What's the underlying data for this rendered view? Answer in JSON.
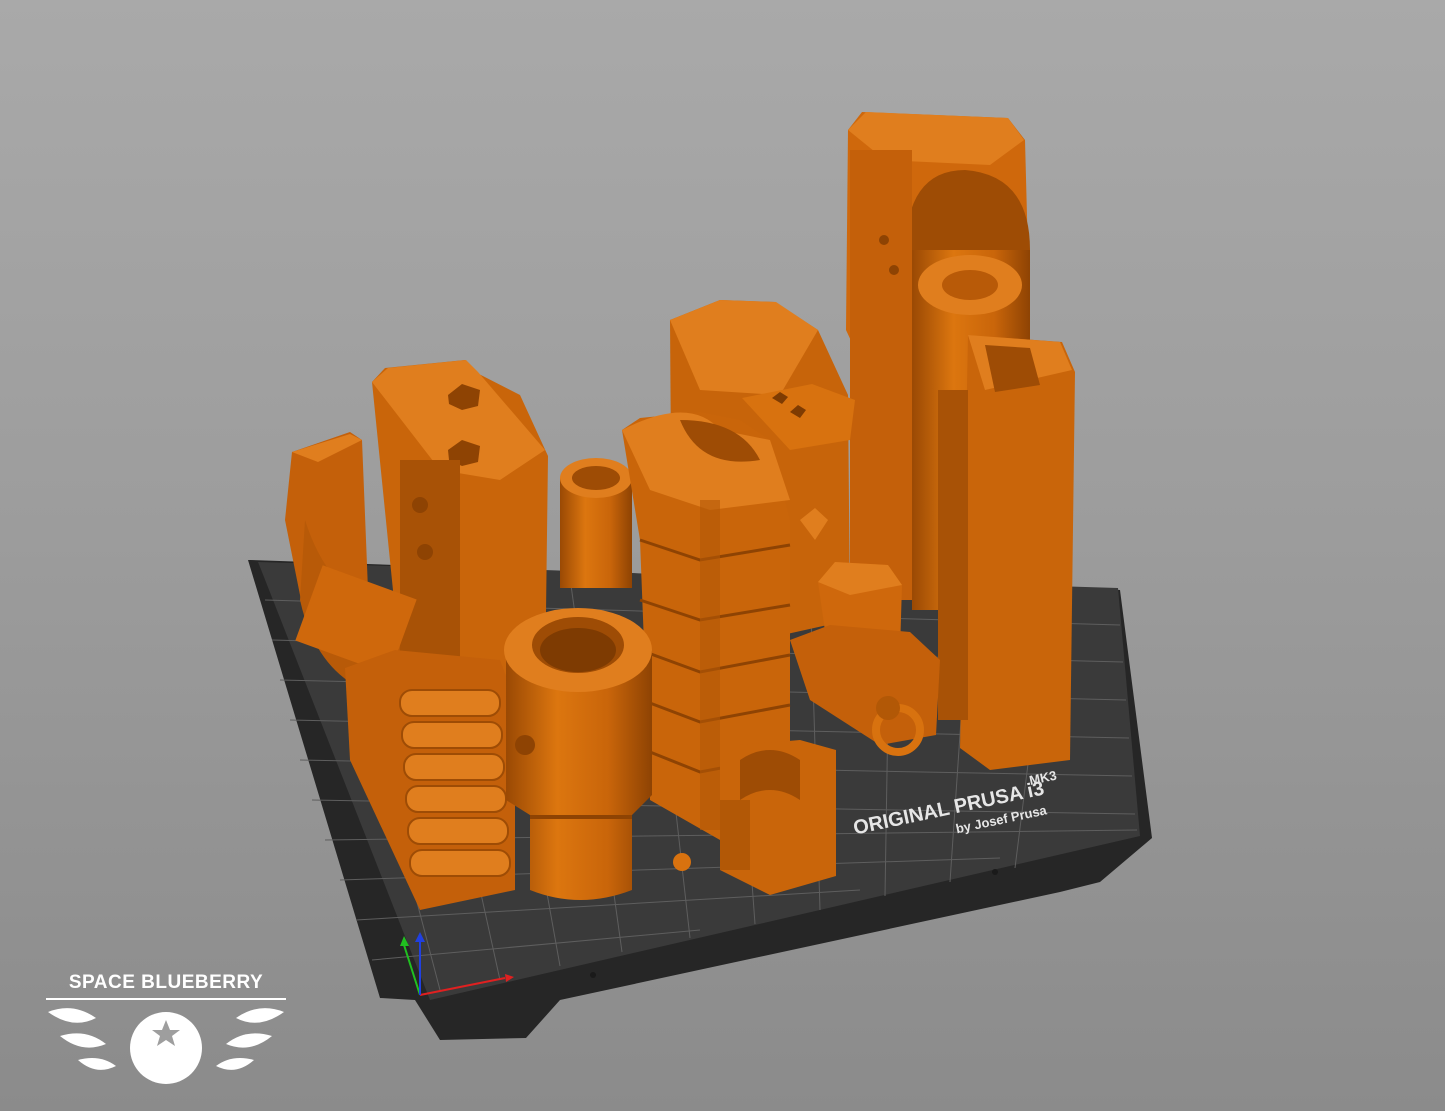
{
  "bed": {
    "label_line1": "ORIGINAL PRUSA i3",
    "label_mk": "MK3",
    "label_line2": "by Josef Prusa"
  },
  "logo": {
    "text": "SPACE BLUEBERRY"
  },
  "colors": {
    "background": "#9e9e9e",
    "bed": "#333333",
    "part": "#d4690a",
    "part_top": "#e6821f",
    "part_shadow": "#9c4a05",
    "grid": "#5c5c5c",
    "axis_x": "#e02020",
    "axis_y": "#20c020",
    "axis_z": "#2040e0"
  },
  "icons": [
    "axis-gizmo-icon",
    "blueberry-logo-icon"
  ]
}
